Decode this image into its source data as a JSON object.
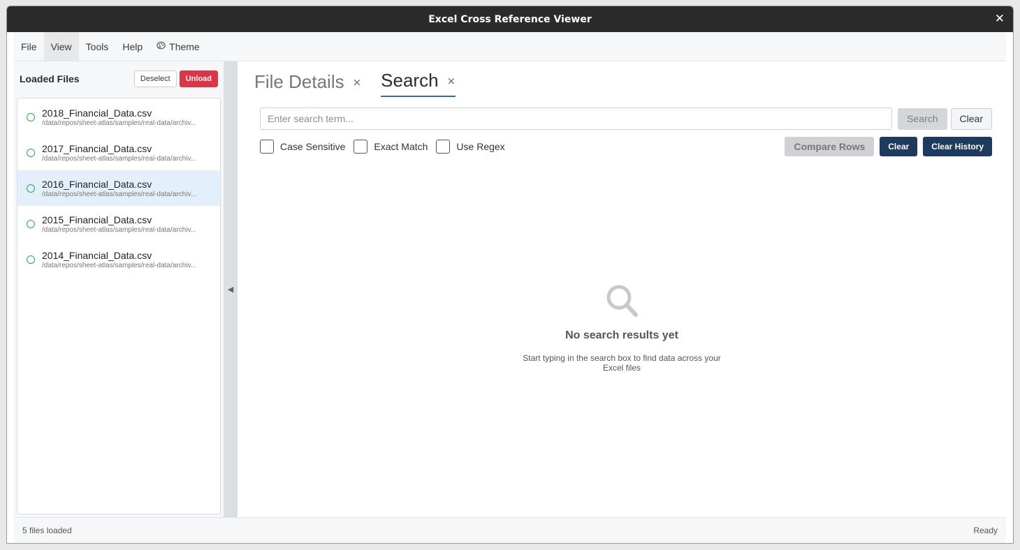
{
  "window": {
    "title": "Excel Cross Reference Viewer"
  },
  "menu": {
    "file": "File",
    "view": "View",
    "tools": "Tools",
    "help": "Help",
    "theme": "Theme"
  },
  "sidebar": {
    "title": "Loaded Files",
    "deselect": "Deselect",
    "unload": "Unload",
    "files": [
      {
        "name": "2018_Financial_Data.csv",
        "path": "/data/repos/sheet-atlas/samples/real-data/archiv..."
      },
      {
        "name": "2017_Financial_Data.csv",
        "path": "/data/repos/sheet-atlas/samples/real-data/archiv..."
      },
      {
        "name": "2016_Financial_Data.csv",
        "path": "/data/repos/sheet-atlas/samples/real-data/archiv..."
      },
      {
        "name": "2015_Financial_Data.csv",
        "path": "/data/repos/sheet-atlas/samples/real-data/archiv..."
      },
      {
        "name": "2014_Financial_Data.csv",
        "path": "/data/repos/sheet-atlas/samples/real-data/archiv..."
      }
    ]
  },
  "tabs": [
    {
      "label": "File Details",
      "close": "×"
    },
    {
      "label": "Search",
      "close": "×"
    }
  ],
  "search": {
    "placeholder": "Enter search term...",
    "value": "",
    "search_btn": "Search",
    "clear_btn": "Clear",
    "options": {
      "case_sensitive": "Case Sensitive",
      "exact_match": "Exact Match",
      "use_regex": "Use Regex"
    },
    "compare_rows": "Compare Rows",
    "clear": "Clear",
    "clear_history": "Clear History"
  },
  "empty_state": {
    "title": "No search results yet",
    "description": "Start typing in the search box to find data across your Excel files"
  },
  "status": {
    "left": "5 files loaded",
    "right": "Ready"
  },
  "colors": {
    "accent": "#2d6db5",
    "danger": "#dc3545",
    "navy": "#1f3a5f",
    "loaded_dot": "#2aa84a",
    "selected_row": "#e3f0fb"
  }
}
